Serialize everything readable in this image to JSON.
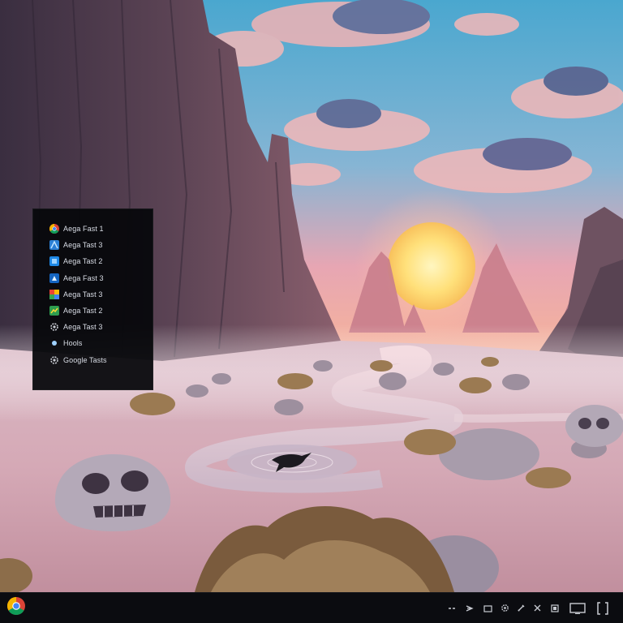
{
  "menu": {
    "items": [
      {
        "label": "Aega Fast 1",
        "icon": "chrome-icon"
      },
      {
        "label": "Aega Tast 3",
        "icon": "app-blue-icon"
      },
      {
        "label": "Aega Tast 2",
        "icon": "app-blue-icon"
      },
      {
        "label": "Aega Fast 3",
        "icon": "app-blue-icon"
      },
      {
        "label": "Aega Tast 3",
        "icon": "app-multicolor-icon"
      },
      {
        "label": "Aega Tast 2",
        "icon": "app-green-icon"
      },
      {
        "label": "Aega Tast 3",
        "icon": "gear-icon"
      },
      {
        "label": "Hools",
        "icon": "dot-icon"
      },
      {
        "label": "Google Tasts",
        "icon": "gear-icon"
      }
    ]
  },
  "taskbar": {
    "start_icon": "chrome-icon",
    "tray_icons": [
      "more-icon",
      "arrow-icon",
      "window-icon",
      "settings-icon",
      "pen-icon",
      "crosshair-icon",
      "screen-icon",
      "display-icon",
      "bracket-icon"
    ]
  },
  "colors": {
    "menu_bg": "#06070b",
    "taskbar_bg": "#0b0c10",
    "menu_text": "#d9dde6"
  }
}
